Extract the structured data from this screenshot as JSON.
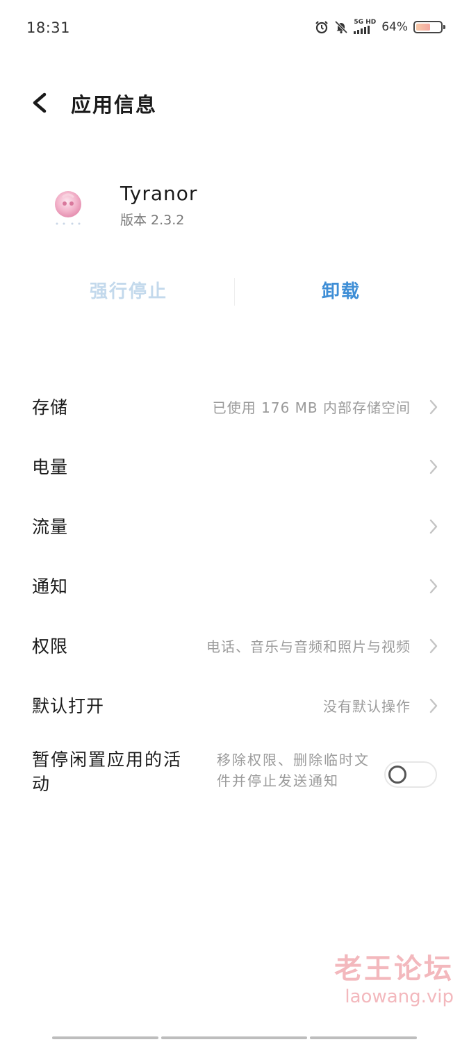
{
  "status_bar": {
    "time": "18:31",
    "network_top": "5G HD",
    "battery_percent": "64%",
    "battery_level": 0.64
  },
  "header": {
    "title": "应用信息"
  },
  "app": {
    "name": "Tyranor",
    "version": "版本 2.3.2"
  },
  "actions": {
    "force_stop": "强行停止",
    "uninstall": "卸载"
  },
  "settings": [
    {
      "label": "存储",
      "value": "已使用 176 MB 内部存储空间"
    },
    {
      "label": "电量",
      "value": ""
    },
    {
      "label": "流量",
      "value": ""
    },
    {
      "label": "通知",
      "value": ""
    },
    {
      "label": "权限",
      "value": "电话、音乐与音频和照片与视频"
    },
    {
      "label": "默认打开",
      "value": "没有默认操作"
    }
  ],
  "pause_activity": {
    "label": "暂停闲置应用的活动",
    "description": "移除权限、删除临时文件并停止发送通知",
    "enabled": false
  },
  "watermark": {
    "cn": "老王论坛",
    "en": "laowang.vip"
  },
  "colors": {
    "accent": "#3e8ed6",
    "disabled_action": "#c3d9ec",
    "secondary_text": "#9a9a9a"
  }
}
